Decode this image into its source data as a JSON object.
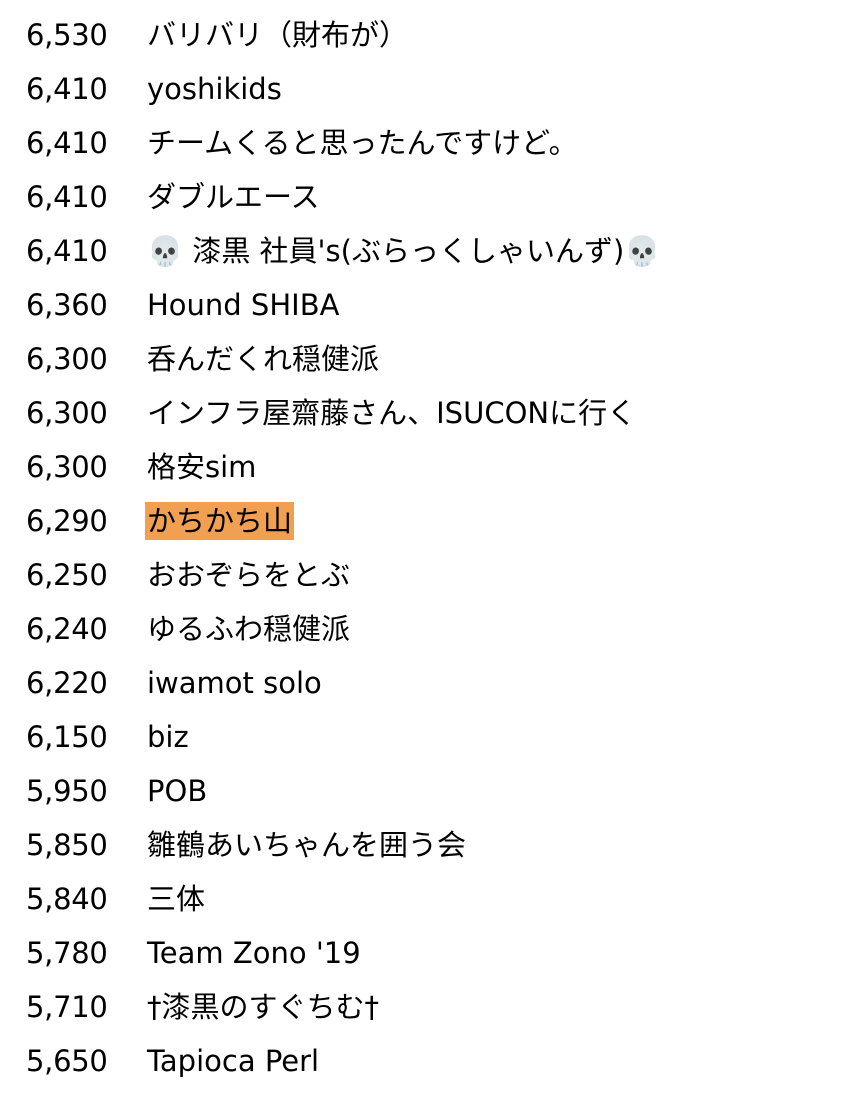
{
  "highlight_color": "#f0a050",
  "rows": [
    {
      "score": "6,530",
      "team": "バリバリ（財布が）"
    },
    {
      "score": "6,410",
      "team": "yoshikids"
    },
    {
      "score": "6,410",
      "team": "チームくると思ったんですけど。"
    },
    {
      "score": "6,410",
      "team": "ダブルエース"
    },
    {
      "score": "6,410",
      "team": "💀 漆黒 社員's(ぶらっくしゃいんず)💀"
    },
    {
      "score": "6,360",
      "team": "Hound SHIBA"
    },
    {
      "score": "6,300",
      "team": "呑んだくれ穏健派"
    },
    {
      "score": "6,300",
      "team": "インフラ屋齋藤さん、ISUCONに行く"
    },
    {
      "score": "6,300",
      "team": "格安sim"
    },
    {
      "score": "6,290",
      "team": "かちかち山",
      "highlighted": true
    },
    {
      "score": "6,250",
      "team": "おおぞらをとぶ"
    },
    {
      "score": "6,240",
      "team": "ゆるふわ穏健派"
    },
    {
      "score": "6,220",
      "team": "iwamot solo"
    },
    {
      "score": "6,150",
      "team": "biz"
    },
    {
      "score": "5,950",
      "team": "POB"
    },
    {
      "score": "5,850",
      "team": "雛鶴あいちゃんを囲う会"
    },
    {
      "score": "5,840",
      "team": "三体"
    },
    {
      "score": "5,780",
      "team": "Team Zono '19"
    },
    {
      "score": "5,710",
      "team": "†漆黒のすぐちむ†"
    },
    {
      "score": "5,650",
      "team": "Tapioca Perl"
    }
  ]
}
